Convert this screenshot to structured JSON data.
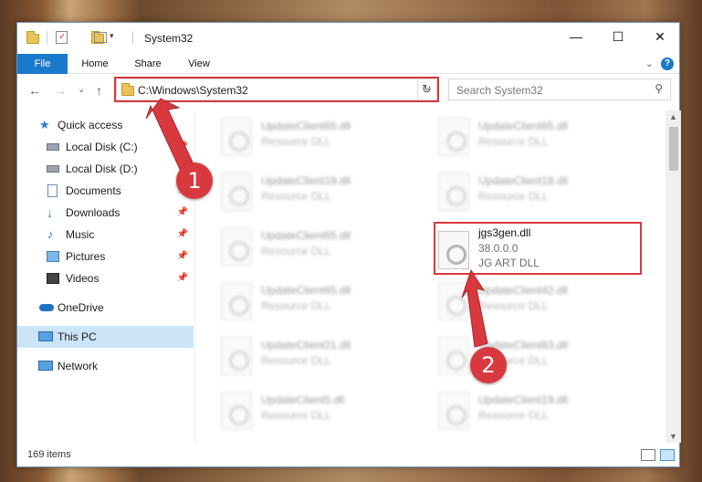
{
  "window": {
    "title": "System32",
    "controls": {
      "minimize": "—",
      "maximize": "☐",
      "close": "✕"
    }
  },
  "ribbon": {
    "tabs": [
      "File",
      "Home",
      "Share",
      "View"
    ],
    "expand": "⌄",
    "help": "?"
  },
  "nav": {
    "back": "←",
    "forward": "→",
    "recent": "⌄",
    "up": "↑",
    "address": "C:\\Windows\\System32",
    "address_dropdown": "⌄",
    "refresh": "↻",
    "search_placeholder": "Search System32",
    "search_icon": "⚲"
  },
  "sidebar": {
    "items": [
      {
        "label": "Quick access",
        "icon": "star-icon",
        "pinned": false
      },
      {
        "label": "Local Disk (C:)",
        "icon": "drive-icon",
        "pinned": true
      },
      {
        "label": "Local Disk (D:)",
        "icon": "drive-icon",
        "pinned": false
      },
      {
        "label": "Documents",
        "icon": "documents-icon",
        "pinned": true
      },
      {
        "label": "Downloads",
        "icon": "download-icon",
        "pinned": true
      },
      {
        "label": "Music",
        "icon": "music-icon",
        "pinned": true
      },
      {
        "label": "Pictures",
        "icon": "pictures-icon",
        "pinned": true
      },
      {
        "label": "Videos",
        "icon": "videos-icon",
        "pinned": true
      },
      {
        "label": "OneDrive",
        "icon": "cloud-icon",
        "pinned": false
      },
      {
        "label": "This PC",
        "icon": "pc-icon",
        "pinned": false,
        "selected": true
      },
      {
        "label": "Network",
        "icon": "network-icon",
        "pinned": false
      }
    ]
  },
  "files": [
    {
      "name": "UpdateClient65.dll",
      "desc": "Resource DLL"
    },
    {
      "name": "UpdateClient65.dll",
      "desc": "Resource DLL"
    },
    {
      "name": "UpdateClient19.dll",
      "desc": "Resource DLL"
    },
    {
      "name": "UpdateClient19.dll",
      "desc": "Resource DLL"
    },
    {
      "name": "UpdateClient65.dll",
      "desc": "Resource DLL"
    },
    {
      "name": "jgs3gen.dll",
      "version": "38.0.0.0",
      "desc": "JG ART DLL",
      "highlighted": true
    },
    {
      "name": "UpdateClient65.dll",
      "desc": "Resource DLL"
    },
    {
      "name": "UpdateClient42.dll",
      "desc": "Resource DLL"
    },
    {
      "name": "UpdateClient21.dll",
      "desc": "Resource DLL"
    },
    {
      "name": "UpdateClient63.dll",
      "desc": "Resource DLL"
    },
    {
      "name": "UpdateClient5.dll",
      "desc": "Resource DLL"
    },
    {
      "name": "UpdateClient19.dll",
      "desc": "Resource DLL"
    }
  ],
  "status": {
    "item_count": "169 items"
  },
  "callouts": {
    "step1": "1",
    "step2": "2"
  },
  "colors": {
    "accent": "#1979ca",
    "highlight": "#d8393f",
    "selected": "#cce4f7"
  },
  "pin_glyph": "📌"
}
